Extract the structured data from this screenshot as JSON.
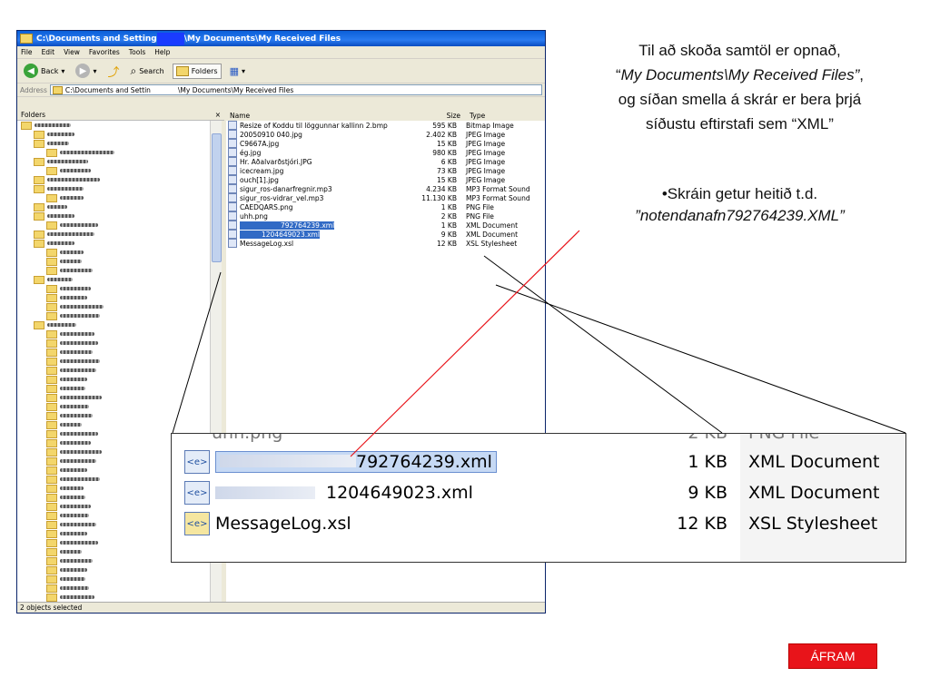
{
  "window": {
    "title_prefix": "C:\\Documents and Setting",
    "title_suffix": "\\My Documents\\My Received Files",
    "menu": [
      "File",
      "Edit",
      "View",
      "Favorites",
      "Tools",
      "Help"
    ],
    "toolbar": {
      "back": "Back",
      "search": "Search",
      "folders": "Folders"
    },
    "address_label": "Address",
    "address_value": "C:\\Documents and Settin",
    "address_value_2": "\\My Documents\\My Received Files",
    "folders_title": "Folders",
    "folders_close": "×",
    "columns": {
      "name": "Name",
      "size": "Size",
      "type": "Type"
    },
    "files": [
      {
        "name": "Resize of Koddu til löggunnar kallinn 2.bmp",
        "size": "595 KB",
        "type": "Bitmap Image"
      },
      {
        "name": "20050910 040.jpg",
        "size": "2.402 KB",
        "type": "JPEG Image"
      },
      {
        "name": "C9667A.jpg",
        "size": "15 KB",
        "type": "JPEG Image"
      },
      {
        "name": "ég.jpg",
        "size": "980 KB",
        "type": "JPEG Image"
      },
      {
        "name": "Hr. Aðalvarðstjóri.JPG",
        "size": "6 KB",
        "type": "JPEG Image"
      },
      {
        "name": "icecream.jpg",
        "size": "73 KB",
        "type": "JPEG Image"
      },
      {
        "name": "ouch[1].jpg",
        "size": "15 KB",
        "type": "JPEG Image"
      },
      {
        "name": "sigur_ros-danarfregnir.mp3",
        "size": "4.234 KB",
        "type": "MP3 Format Sound"
      },
      {
        "name": "sigur_ros-vidrar_vel.mp3",
        "size": "11.130 KB",
        "type": "MP3 Format Sound"
      },
      {
        "name": "CAEDQARS.png",
        "size": "1 KB",
        "type": "PNG File"
      },
      {
        "name": "uhh.png",
        "size": "2 KB",
        "type": "PNG File"
      },
      {
        "name": "792764239.xml",
        "size": "1 KB",
        "type": "XML Document"
      },
      {
        "name": "1204649023.xml",
        "size": "9 KB",
        "type": "XML Document"
      },
      {
        "name": "MessageLog.xsl",
        "size": "12 KB",
        "type": "XSL Stylesheet"
      }
    ],
    "status": "2 objects selected"
  },
  "caption": {
    "line1": "Til að skoða samtöl er opnað,",
    "line2_open": "“",
    "line2_italic": "My Documents\\My Received Files”",
    "line2_close": ",",
    "line3": "og síðan smella á skrár er bera þrjá",
    "line4": "síðustu eftirstafi sem “XML”",
    "line5": "•Skráin getur heitið t.d.",
    "line6": "”notendanafn792764239.XML”"
  },
  "zoom": {
    "top_partial": "uhh.png",
    "top_partial_size": "2 KB",
    "top_partial_type": "PNG File",
    "rows": [
      {
        "name": "792764239.xml",
        "size": "1 KB",
        "type": "XML Document"
      },
      {
        "name": "1204649023.xml",
        "size": "9 KB",
        "type": "XML Document"
      },
      {
        "name": "MessageLog.xsl",
        "size": "12 KB",
        "type": "XSL Stylesheet"
      }
    ]
  },
  "button": {
    "next": "ÁFRAM"
  },
  "colors": {
    "selection": "#316ac5",
    "annotation_line": "#e8141a",
    "button": "#e8141a"
  }
}
